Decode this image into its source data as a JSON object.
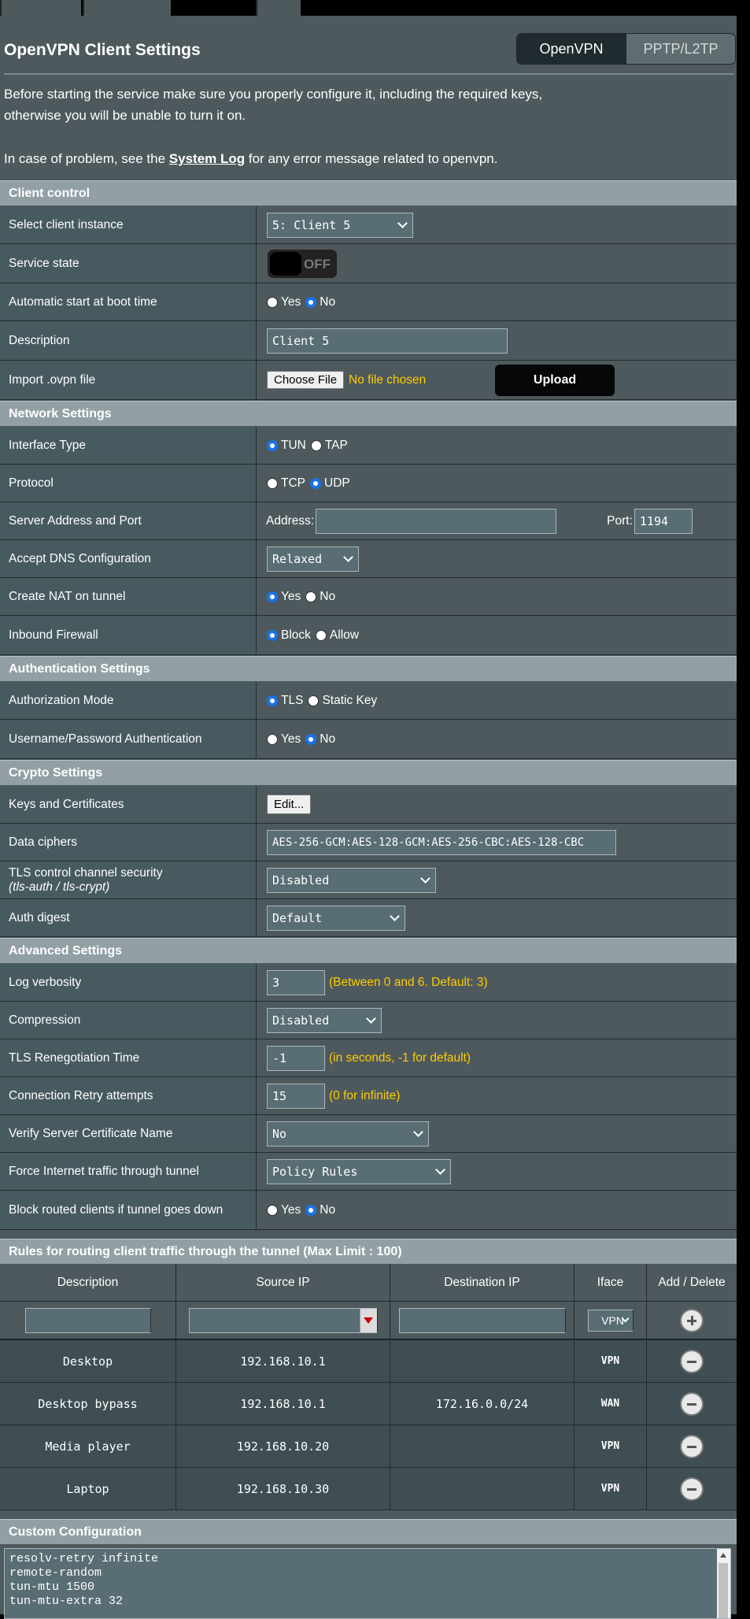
{
  "page_title": "OpenVPN Client Settings",
  "tabs": [
    {
      "label": "OpenVPN"
    },
    {
      "label": "PPTP/L2TP"
    }
  ],
  "intro": {
    "line1": "Before starting the service make sure you properly configure it, including the required keys,",
    "line2": "otherwise you will be unable to turn it on.",
    "line3_pre": "In case of problem, see the ",
    "line3_link": "System Log",
    "line3_post": " for any error message related to openvpn."
  },
  "sections": {
    "client_control": "Client control",
    "network": "Network Settings",
    "auth": "Authentication Settings",
    "crypto": "Crypto Settings",
    "advanced": "Advanced Settings",
    "rules": "Rules for routing client traffic through the tunnel (Max Limit : 100)",
    "custom": "Custom Configuration"
  },
  "labels": {
    "client_instance": "Select client instance",
    "service_state": "Service state",
    "auto_start": "Automatic start at boot time",
    "description": "Description",
    "import_ovpn": "Import .ovpn file",
    "interface_type": "Interface Type",
    "protocol": "Protocol",
    "server_address": "Server Address and Port",
    "accept_dns": "Accept DNS Configuration",
    "create_nat": "Create NAT on tunnel",
    "inbound_fw": "Inbound Firewall",
    "auth_mode": "Authorization Mode",
    "user_pass": "Username/Password Authentication",
    "keys_certs": "Keys and Certificates",
    "data_ciphers": "Data ciphers",
    "tls_control": "TLS control channel security",
    "tls_control_sub": "(tls-auth / tls-crypt)",
    "auth_digest": "Auth digest",
    "log_verbosity": "Log verbosity",
    "compression": "Compression",
    "tls_reneg": "TLS Renegotiation Time",
    "retry": "Connection Retry attempts",
    "verify_cert": "Verify Server Certificate Name",
    "force_internet": "Force Internet traffic through tunnel",
    "block_routed": "Block routed clients if tunnel goes down"
  },
  "values": {
    "client_instance": "5: Client 5",
    "service_state": "OFF",
    "description": "Client 5",
    "choose_file": "Choose File",
    "no_file": "No file chosen",
    "upload": "Upload",
    "address_label": "Address:",
    "address": "",
    "port_label": "Port:",
    "port": "1194",
    "accept_dns": "Relaxed",
    "edit": "Edit...",
    "data_ciphers": "AES-256-GCM:AES-128-GCM:AES-256-CBC:AES-128-CBC",
    "tls_control": "Disabled",
    "auth_digest": "Default",
    "log_verbosity": "3",
    "log_hint": "(Between 0 and 6. Default: 3)",
    "compression": "Disabled",
    "tls_reneg": "-1",
    "tls_reneg_hint": "(in seconds, -1 for default)",
    "retry": "15",
    "retry_hint": "(0 for infinite)",
    "verify_cert": "No",
    "force_internet": "Policy Rules"
  },
  "radio": {
    "yes": "Yes",
    "no": "No",
    "tun": "TUN",
    "tap": "TAP",
    "tcp": "TCP",
    "udp": "UDP",
    "block": "Block",
    "allow": "Allow",
    "tls": "TLS",
    "static_key": "Static Key"
  },
  "rules_table": {
    "headers": [
      "Description",
      "Source IP",
      "Destination IP",
      "Iface",
      "Add / Delete"
    ],
    "iface_default": "VPN",
    "rows": [
      {
        "desc": "Desktop",
        "src": "192.168.10.1",
        "dst": "",
        "iface": "VPN"
      },
      {
        "desc": "Desktop bypass",
        "src": "192.168.10.1",
        "dst": "172.16.0.0/24",
        "iface": "WAN"
      },
      {
        "desc": "Media player",
        "src": "192.168.10.20",
        "dst": "",
        "iface": "VPN"
      },
      {
        "desc": "Laptop",
        "src": "192.168.10.30",
        "dst": "",
        "iface": "VPN"
      }
    ]
  },
  "custom_config": "resolv-retry infinite\nremote-random\ntun-mtu 1500\ntun-mtu-extra 32"
}
